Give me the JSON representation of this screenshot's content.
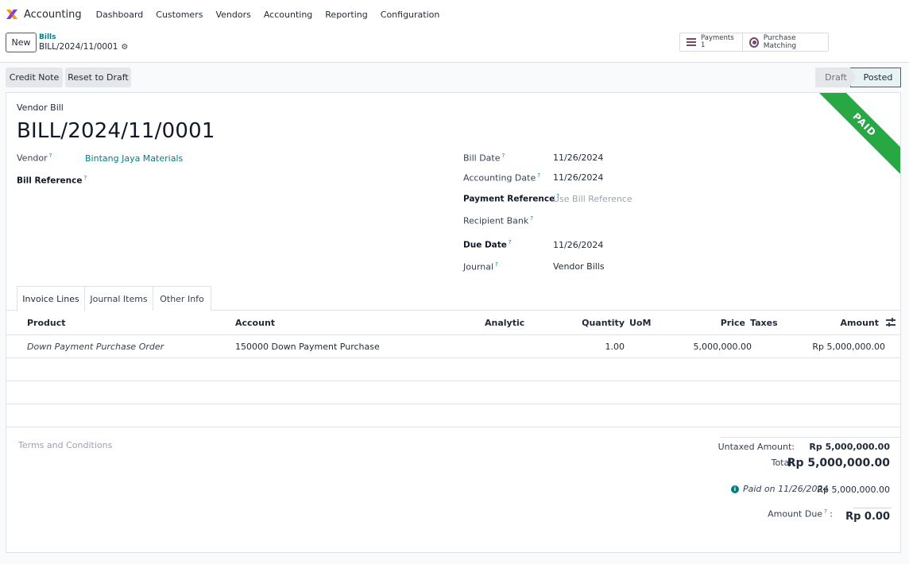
{
  "navbar": {
    "app_title": "Accounting",
    "menu": [
      "Dashboard",
      "Customers",
      "Vendors",
      "Accounting",
      "Reporting",
      "Configuration"
    ]
  },
  "control": {
    "new_label": "New",
    "breadcrumb_parent": "Bills",
    "breadcrumb_current": "BILL/2024/11/0001",
    "payments_label": "Payments",
    "payments_count": "1",
    "purchase_matching_label": "Purchase Matching"
  },
  "actions": {
    "credit_note": "Credit Note",
    "reset_to_draft": "Reset to Draft"
  },
  "status": {
    "draft": "Draft",
    "posted": "Posted",
    "ribbon": "PAID"
  },
  "form": {
    "kind": "Vendor Bill",
    "title": "BILL/2024/11/0001",
    "vendor_label": "Vendor",
    "vendor_value": "Bintang Jaya Materials",
    "bill_reference_label": "Bill Reference",
    "bill_date_label": "Bill Date",
    "bill_date_value": "11/26/2024",
    "accounting_date_label": "Accounting Date",
    "accounting_date_value": "11/26/2024",
    "payment_reference_label": "Payment Reference",
    "payment_reference_placeholder": "Use Bill Reference",
    "recipient_bank_label": "Recipient Bank",
    "due_date_label": "Due Date",
    "due_date_value": "11/26/2024",
    "journal_label": "Journal",
    "journal_value": "Vendor Bills",
    "help_mark": "?"
  },
  "tabs": [
    "Invoice Lines",
    "Journal Items",
    "Other Info"
  ],
  "table": {
    "headers": {
      "product": "Product",
      "account": "Account",
      "analytic": "Analytic",
      "quantity": "Quantity",
      "uom": "UoM",
      "price": "Price",
      "taxes": "Taxes",
      "amount": "Amount"
    },
    "rows": [
      {
        "product": "Down Payment Purchase Order",
        "account": "150000 Down Payment Purchase",
        "quantity": "1.00",
        "price": "5,000,000.00",
        "amount": "Rp 5,000,000.00"
      }
    ]
  },
  "footer": {
    "terms_placeholder": "Terms and Conditions",
    "untaxed_label": "Untaxed Amount:",
    "untaxed_value": "Rp 5,000,000.00",
    "total_label": "Total:",
    "total_value": "Rp 5,000,000.00",
    "paid_on_label": "Paid on 11/26/2024",
    "paid_on_value": "Rp 5,000,000.00",
    "amount_due_label": "Amount Due",
    "amount_due_colon": ":",
    "amount_due_value": "Rp 0.00"
  },
  "colors": {
    "primary": "#714b67",
    "link": "#017e84",
    "paid_ribbon": "#28a745"
  }
}
